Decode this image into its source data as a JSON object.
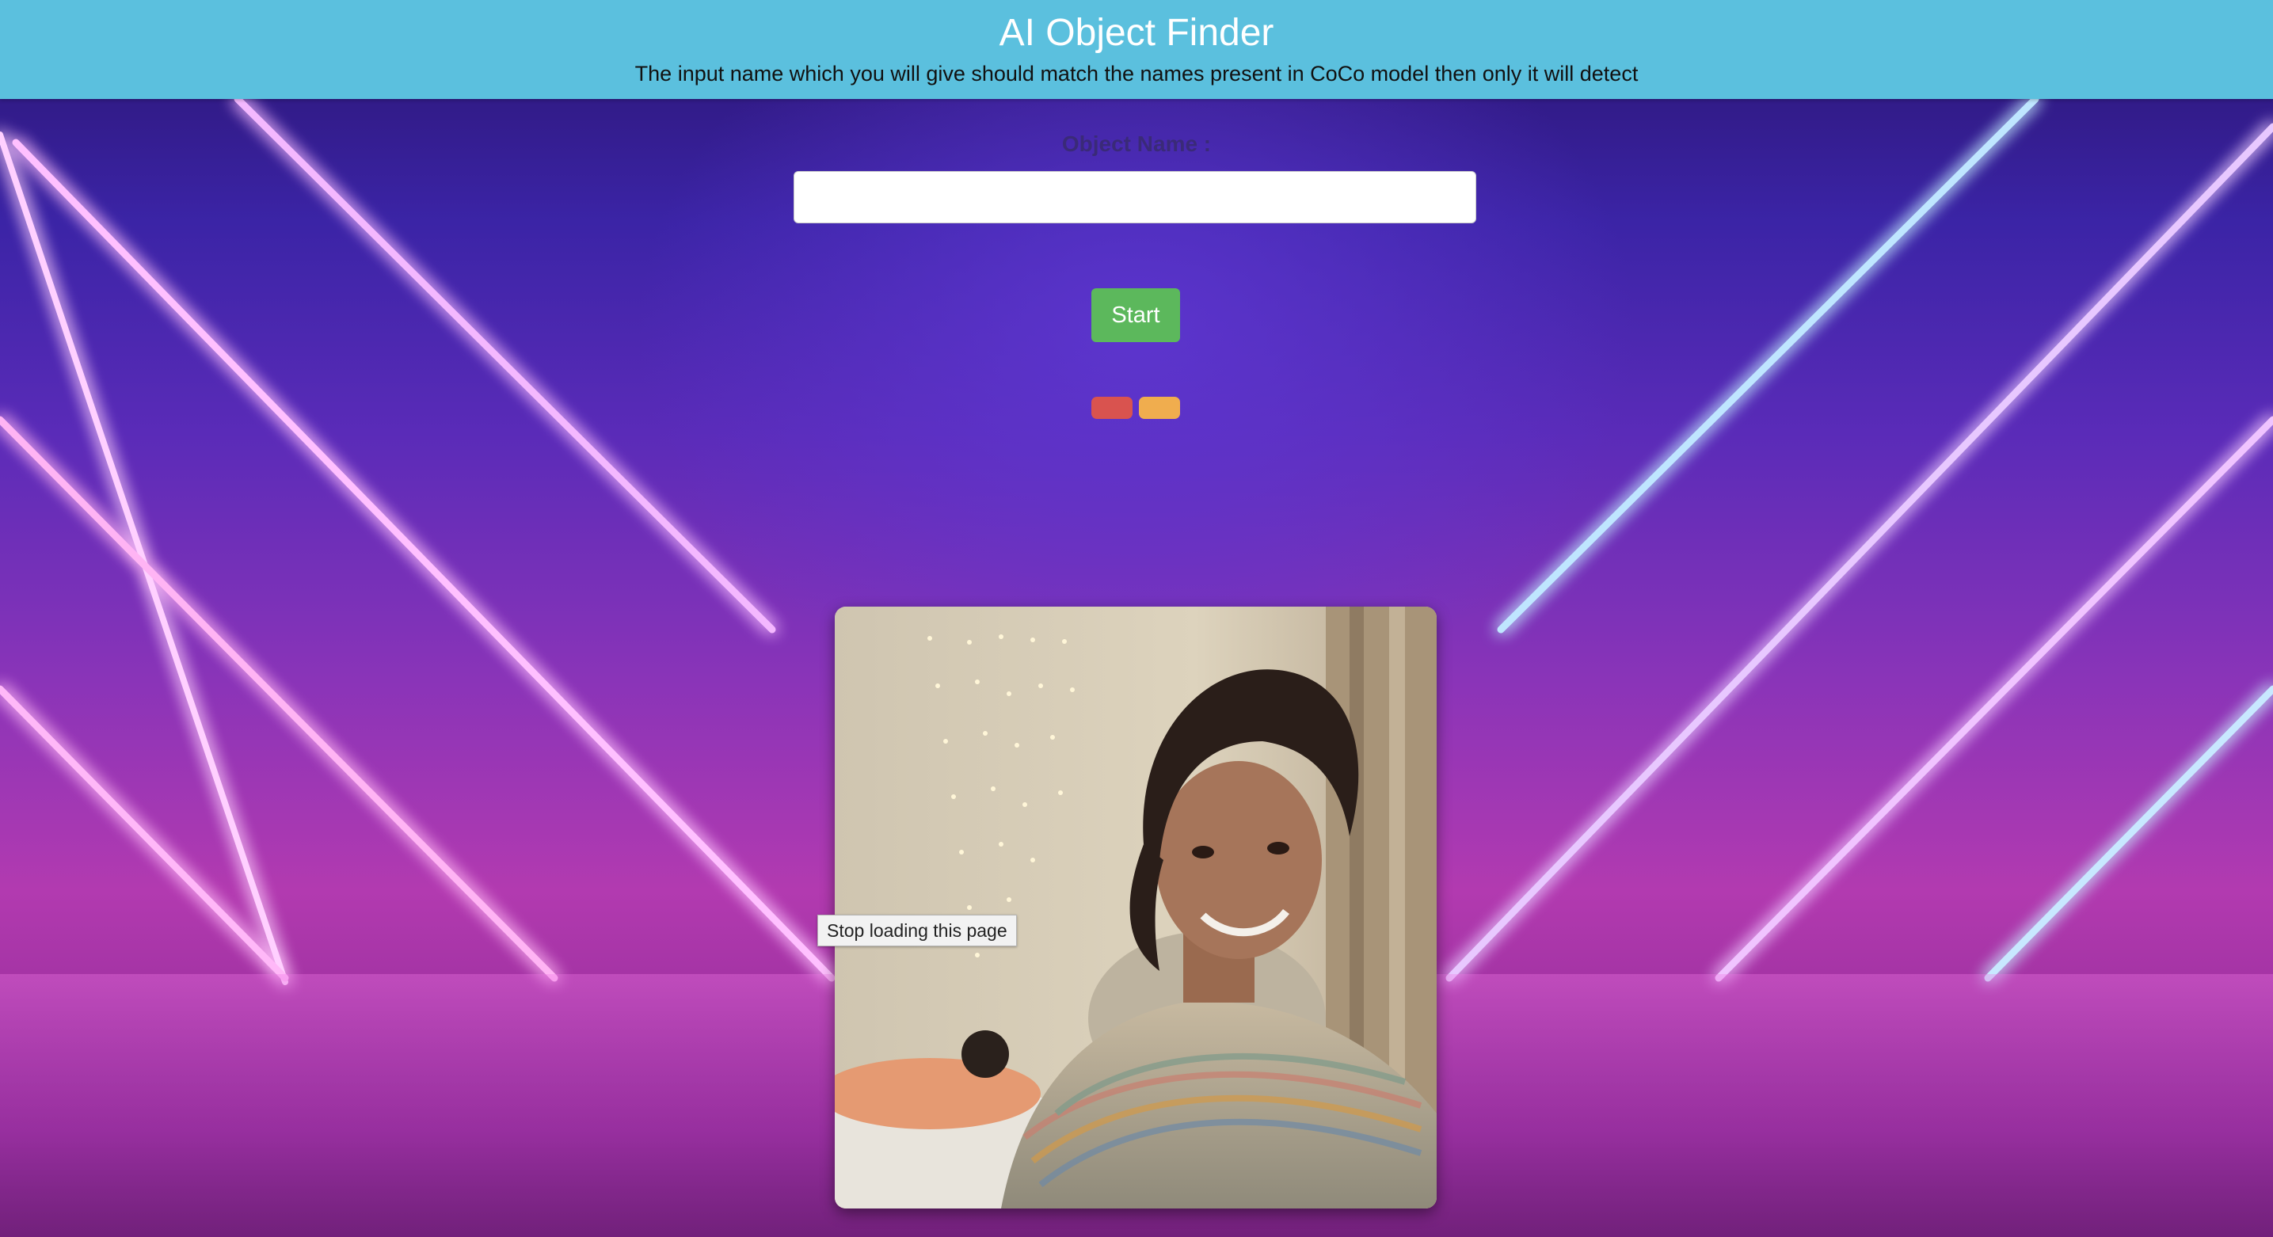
{
  "header": {
    "title": "AI Object Finder",
    "subtitle": "The input name which you will give should match the names present in CoCo model then only it will detect"
  },
  "form": {
    "label": "Object Name :",
    "input_value": "",
    "input_placeholder": "",
    "start_label": "Start"
  },
  "controls": {
    "stop_color": "#d9534f",
    "pause_color": "#f0ad4e"
  },
  "tooltip": {
    "text": "Stop loading this page"
  },
  "colors": {
    "header_bg": "#5bc0de",
    "start_button": "#5cb85c",
    "stop_button": "#d9534f",
    "pause_button": "#f0ad4e"
  }
}
